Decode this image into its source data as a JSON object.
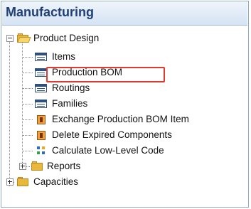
{
  "header": {
    "title": "Manufacturing"
  },
  "tree": {
    "product_design": "Product Design",
    "items": [
      {
        "label": "Items",
        "icon": "list-icon"
      },
      {
        "label": "Production BOM",
        "icon": "list-icon",
        "highlighted": true
      },
      {
        "label": "Routings",
        "icon": "list-icon"
      },
      {
        "label": "Families",
        "icon": "list-icon"
      },
      {
        "label": "Exchange Production BOM Item",
        "icon": "action-icon"
      },
      {
        "label": "Delete Expired Components",
        "icon": "action-icon"
      },
      {
        "label": "Calculate Low-Level Code",
        "icon": "calc-icon"
      }
    ],
    "reports": "Reports",
    "capacities": "Capacities"
  },
  "colors": {
    "header_text": "#1f3f77",
    "highlight": "#e0392f"
  }
}
